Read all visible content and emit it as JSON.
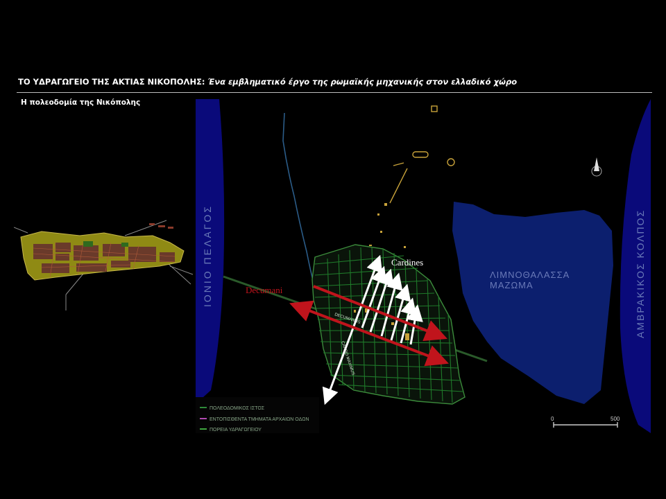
{
  "header": {
    "title_main": "ΤΟ ΥΔΡΑΓΩΓΕΙΟ ΤΗΣ ΑΚΤΙΑΣ ΝΙΚΟΠΟΛΗΣ: ",
    "title_italic": "Ένα εμβληματικό έργο της ρωμαϊκής μηχανικής στον ελλαδικό χώρο",
    "subtitle": "Η πολεοδομία της Νικόπολης"
  },
  "map": {
    "sea_left": "ΙΟΝΙΟ ΠΕΛΑΓΟΣ",
    "sea_right": "ΑΜΒΡΑΚΙΚΟΣ ΚΟΛΠΟΣ",
    "lagoon_line1": "ΛΙΜΝΟΘΑΛΑΣΣΑ",
    "lagoon_line2": "ΜΑΖΩΜΑ",
    "cardines_label": "Cardines",
    "decumani_label": "Decumani",
    "street_label_1": "DECUMANUS",
    "street_label_2": "CARDO MAXIMUS",
    "legend": [
      {
        "label": "ΠΟΛΕΟΔΟΜΙΚΟΣ ΙΣΤΟΣ",
        "color": "#2e8b3a"
      },
      {
        "label": "ΕΝΤΟΠΙΣΘΕΝΤΑ ΤΜΗΜΑΤΑ ΑΡΧΑΙΩΝ ΟΔΩΝ",
        "color": "#b04ab0"
      },
      {
        "label": "ΠΟΡΕΙΑ ΥΔΡΑΓΩΓΕΙΟΥ",
        "color": "#3fa83f"
      }
    ],
    "scale": {
      "start": "0",
      "end": "500"
    }
  },
  "colors": {
    "sea": "#0a0a7a",
    "lagoon": "#0c1f6e",
    "grid": "#1f7a2a",
    "arrow_red": "#c0141c",
    "arrow_white": "#ffffff"
  }
}
